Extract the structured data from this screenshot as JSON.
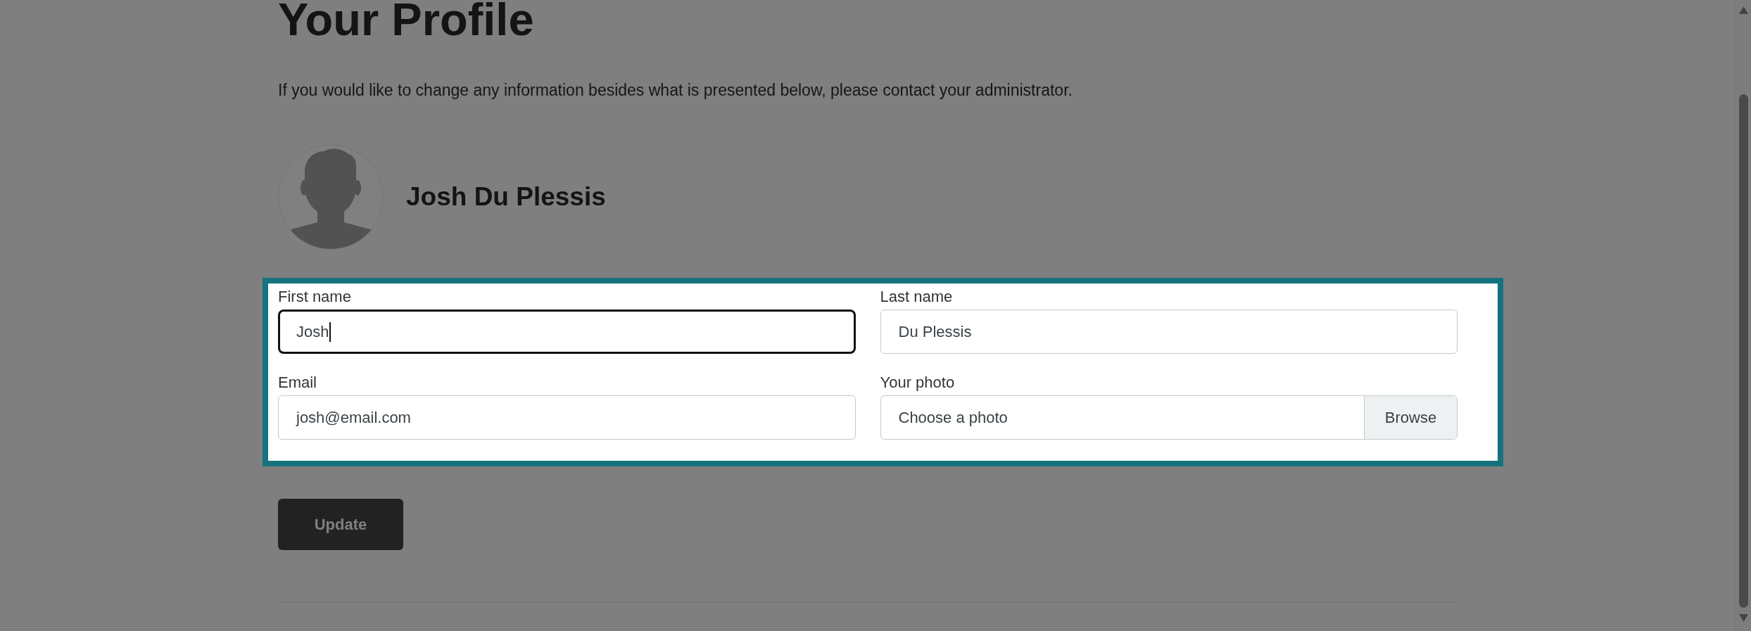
{
  "page": {
    "title": "Your Profile",
    "intro": "If you would like to change any information besides what is presented below, please contact your administrator."
  },
  "profile": {
    "name": "Josh Du Plessis"
  },
  "form": {
    "highlighted": true,
    "fields": [
      {
        "kind": "text",
        "label": "First name",
        "value": "Josh",
        "focused": true
      },
      {
        "kind": "text",
        "label": "Last name",
        "value": "Du Plessis",
        "focused": false
      },
      {
        "kind": "text",
        "label": "Email",
        "value": "josh@email.com",
        "focused": false
      },
      {
        "kind": "file",
        "label": "Your photo",
        "placeholder": "Choose a photo",
        "button": "Browse",
        "focused": false
      }
    ]
  },
  "actions": {
    "update_button": "Update"
  }
}
